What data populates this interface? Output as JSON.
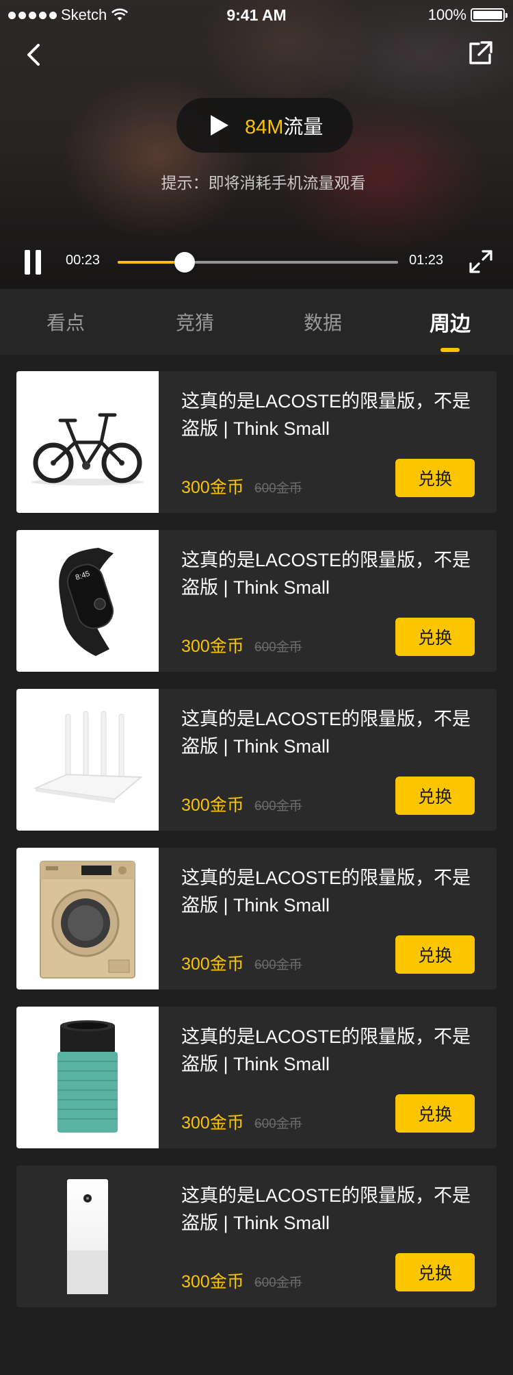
{
  "status_bar": {
    "carrier": "Sketch",
    "time": "9:41 AM",
    "battery": "100%"
  },
  "player": {
    "play_data_amount": "84M",
    "play_data_label": "流量",
    "hint": "提示：即将消耗手机流量观看",
    "current_time": "00:23",
    "total_time": "01:23",
    "progress": 0.24
  },
  "tabs": [
    {
      "label": "看点"
    },
    {
      "label": "竞猜"
    },
    {
      "label": "数据"
    },
    {
      "label": "周边"
    }
  ],
  "active_tab": 3,
  "products": [
    {
      "title": "这真的是LACOSTE的限量版，不是盗版 | Think Small",
      "price": "300金币",
      "original_price": "600金币",
      "button": "兑换",
      "image_icon": "folding-bike-icon"
    },
    {
      "title": "这真的是LACOSTE的限量版，不是盗版 | Think Small",
      "price": "300金币",
      "original_price": "600金币",
      "button": "兑换",
      "image_icon": "fitness-band-icon"
    },
    {
      "title": "这真的是LACOSTE的限量版，不是盗版 | Think Small",
      "price": "300金币",
      "original_price": "600金币",
      "button": "兑换",
      "image_icon": "wifi-router-icon"
    },
    {
      "title": "这真的是LACOSTE的限量版，不是盗版 | Think Small",
      "price": "300金币",
      "original_price": "600金币",
      "button": "兑换",
      "image_icon": "washing-machine-icon"
    },
    {
      "title": "这真的是LACOSTE的限量版，不是盗版 | Think Small",
      "price": "300金币",
      "original_price": "600金币",
      "button": "兑换",
      "image_icon": "air-filter-icon"
    },
    {
      "title": "这真的是LACOSTE的限量版，不是盗版 | Think Small",
      "price": "300金币",
      "original_price": "600金币",
      "button": "兑换",
      "image_icon": "air-purifier-icon"
    }
  ],
  "colors": {
    "accent": "#f9c300",
    "background": "#1f1f1f",
    "card": "#2a2a2a"
  }
}
